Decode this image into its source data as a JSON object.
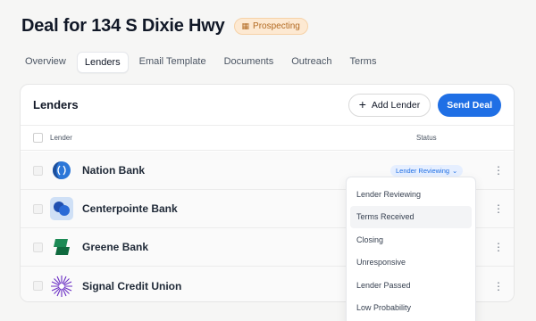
{
  "header": {
    "title": "Deal for 134 S Dixie Hwy",
    "badge": "Prospecting",
    "badge_icon": "building-icon"
  },
  "tabs": [
    {
      "label": "Overview",
      "active": false
    },
    {
      "label": "Lenders",
      "active": true
    },
    {
      "label": "Email Template",
      "active": false
    },
    {
      "label": "Documents",
      "active": false
    },
    {
      "label": "Outreach",
      "active": false
    },
    {
      "label": "Terms",
      "active": false
    }
  ],
  "lenders_card": {
    "title": "Lenders",
    "add_button": "Add Lender",
    "send_button": "Send Deal",
    "columns": {
      "lender": "Lender",
      "status": "Status"
    },
    "rows": [
      {
        "name": "Nation Bank",
        "status": "Lender Reviewing",
        "logo": "nation-bank-logo"
      },
      {
        "name": "Centerpointe Bank",
        "status": "",
        "logo": "centerpointe-bank-logo"
      },
      {
        "name": "Greene Bank",
        "status": "",
        "logo": "greene-bank-logo"
      },
      {
        "name": "Signal Credit Union",
        "status": "",
        "logo": "signal-credit-union-logo"
      }
    ]
  },
  "status_dropdown": {
    "options": [
      "Lender Reviewing",
      "Terms Received",
      "Closing",
      "Unresponsive",
      "Lender Passed",
      "Low Probability"
    ],
    "hovered": "Terms Received"
  },
  "colors": {
    "accent": "#1f6fe5",
    "badge_bg": "#fde9d2",
    "badge_text": "#b26a22"
  }
}
